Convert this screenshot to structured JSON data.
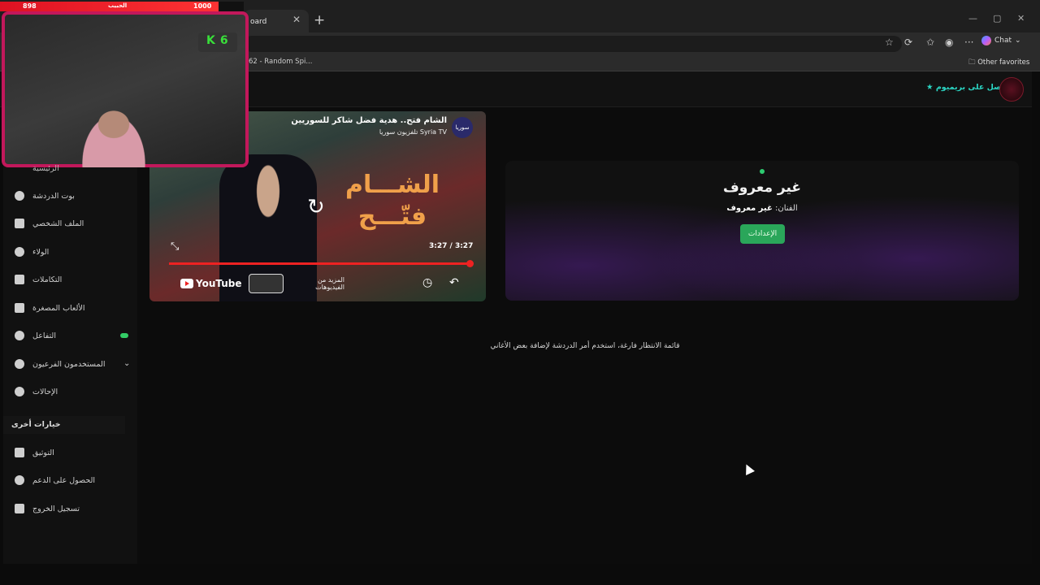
{
  "browser": {
    "tab_title": "oard",
    "bookmark": "62 - Random Spi...",
    "other_favorites": "Other favorites",
    "chat_label": "Chat"
  },
  "header": {
    "premium_label": "احصل على بريميوم"
  },
  "sidebar": {
    "peek_label": "الرئيسية",
    "items": [
      {
        "label": "بوت الدردشة",
        "icon": "bot-icon"
      },
      {
        "label": "الملف الشخصي",
        "icon": "profile-card-icon"
      },
      {
        "label": "الولاء",
        "icon": "trophy-icon"
      },
      {
        "label": "التكاملات",
        "icon": "integrations-icon"
      },
      {
        "label": "الألعاب المصغرة",
        "icon": "gamepad-icon"
      },
      {
        "label": "التفاعل",
        "icon": "music-note-icon"
      },
      {
        "label": "المستخدمون الفرعيون",
        "icon": "users-icon"
      },
      {
        "label": "الإحالات",
        "icon": "referrals-icon"
      }
    ],
    "section_title": "خيارات أخرى",
    "other_items": [
      {
        "label": "التوثيق",
        "icon": "scroll-icon"
      },
      {
        "label": "الحصول على الدعم",
        "icon": "help-icon"
      },
      {
        "label": "تسجيل الخروج",
        "icon": "logout-icon"
      }
    ]
  },
  "now_playing": {
    "title": "غير معروف",
    "artist_label": "الفنان:",
    "artist_value": "غير معروف",
    "settings_button": "الإعدادات"
  },
  "queue": {
    "empty_message": "قائمة الانتظار فارغة، استخدم أمر الدردشة لإضافة بعض الأغاني"
  },
  "video": {
    "title": "الشام فتح.. هدية فضل شاكر للسوريين",
    "channel": "Syria TV تلفزيون سوريا",
    "channel_logo": "سوريا",
    "overlay_text": "الشـــام فتّـــح",
    "time": "3:27 / 3:27",
    "progress": 1.0,
    "youtube_label": "YouTube",
    "more_videos": "المزيد من الفيديوهات"
  },
  "webcam": {
    "badge_letter": "K",
    "badge_count": "6",
    "hp_left": "898",
    "hp_mid": "الحبيب",
    "hp_right": "1000",
    "hp_fraction": 0.898
  },
  "colors": {
    "accent_green": "#2aa65a",
    "premium_teal": "#2bd6c4",
    "progress_red": "#ee2222",
    "webcam_border": "#c2185b"
  }
}
